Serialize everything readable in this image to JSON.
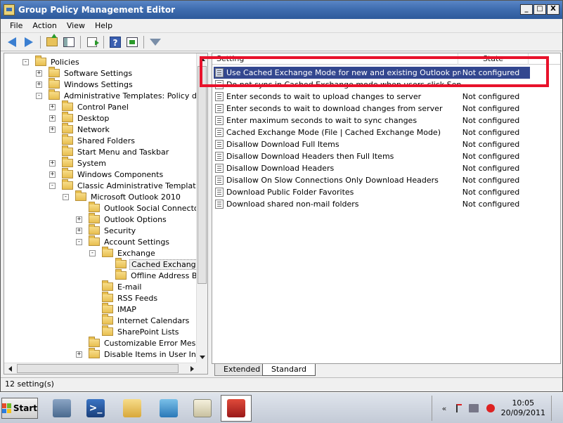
{
  "window": {
    "title": "Group Policy Management Editor",
    "btn_min": "_",
    "btn_max": "□",
    "btn_close": "X"
  },
  "menu": [
    "File",
    "Action",
    "View",
    "Help"
  ],
  "tree": [
    {
      "label": "Policies",
      "exp": "-",
      "depth": 1
    },
    {
      "label": "Software Settings",
      "exp": "+",
      "depth": 2
    },
    {
      "label": "Windows Settings",
      "exp": "+",
      "depth": 2
    },
    {
      "label": "Administrative Templates: Policy definiti",
      "exp": "-",
      "depth": 2
    },
    {
      "label": "Control Panel",
      "exp": "+",
      "depth": 3
    },
    {
      "label": "Desktop",
      "exp": "+",
      "depth": 3
    },
    {
      "label": "Network",
      "exp": "+",
      "depth": 3
    },
    {
      "label": "Shared Folders",
      "exp": "",
      "depth": 3
    },
    {
      "label": "Start Menu and Taskbar",
      "exp": "",
      "depth": 3
    },
    {
      "label": "System",
      "exp": "+",
      "depth": 3
    },
    {
      "label": "Windows Components",
      "exp": "+",
      "depth": 3
    },
    {
      "label": "Classic Administrative Templates (AD",
      "exp": "-",
      "depth": 3
    },
    {
      "label": "Microsoft Outlook 2010",
      "exp": "-",
      "depth": 4
    },
    {
      "label": "Outlook Social Connector",
      "exp": "",
      "depth": 5
    },
    {
      "label": "Outlook Options",
      "exp": "+",
      "depth": 5
    },
    {
      "label": "Security",
      "exp": "+",
      "depth": 5
    },
    {
      "label": "Account Settings",
      "exp": "-",
      "depth": 5
    },
    {
      "label": "Exchange",
      "exp": "-",
      "depth": 6
    },
    {
      "label": "Cached Exchange M",
      "exp": "",
      "depth": 7,
      "selected": true
    },
    {
      "label": "Offline Address Boo",
      "exp": "",
      "depth": 7
    },
    {
      "label": "E-mail",
      "exp": "",
      "depth": 6
    },
    {
      "label": "RSS Feeds",
      "exp": "",
      "depth": 6
    },
    {
      "label": "IMAP",
      "exp": "",
      "depth": 6
    },
    {
      "label": "Internet Calendars",
      "exp": "",
      "depth": 6
    },
    {
      "label": "SharePoint Lists",
      "exp": "",
      "depth": 6
    },
    {
      "label": "Customizable Error Message",
      "exp": "",
      "depth": 5
    },
    {
      "label": "Disable Items in User Interfa",
      "exp": "+",
      "depth": 5
    }
  ],
  "columns": {
    "setting": "Setting",
    "state": "State"
  },
  "settings": [
    {
      "name": "Use Cached Exchange Mode for new and existing Outlook profiles",
      "state": "Not configured",
      "selected": true
    },
    {
      "name": "Do not sync in Cached Exchange mode when users click Send/Re",
      "state": ""
    },
    {
      "name": "Enter seconds to wait to upload changes to server",
      "state": "Not configured"
    },
    {
      "name": "Enter seconds to wait to download changes from server",
      "state": "Not configured"
    },
    {
      "name": "Enter maximum seconds to wait to sync changes",
      "state": "Not configured"
    },
    {
      "name": "Cached Exchange Mode (File | Cached Exchange Mode)",
      "state": "Not configured"
    },
    {
      "name": "Disallow Download Full Items",
      "state": "Not configured"
    },
    {
      "name": "Disallow Download Headers then Full Items",
      "state": "Not configured"
    },
    {
      "name": "Disallow Download Headers",
      "state": "Not configured"
    },
    {
      "name": "Disallow On Slow Connections Only Download Headers",
      "state": "Not configured"
    },
    {
      "name": "Download Public Folder Favorites",
      "state": "Not configured"
    },
    {
      "name": "Download shared non-mail folders",
      "state": "Not configured"
    }
  ],
  "tabs": {
    "extended": "Extended",
    "standard": "Standard"
  },
  "status": "12 setting(s)",
  "taskbar": {
    "start": "Start",
    "time": "10:05",
    "date": "20/09/2011",
    "tray_chevron": "«"
  },
  "colors": {
    "selection": "#33478f",
    "highlight_box": "#e8122b"
  }
}
